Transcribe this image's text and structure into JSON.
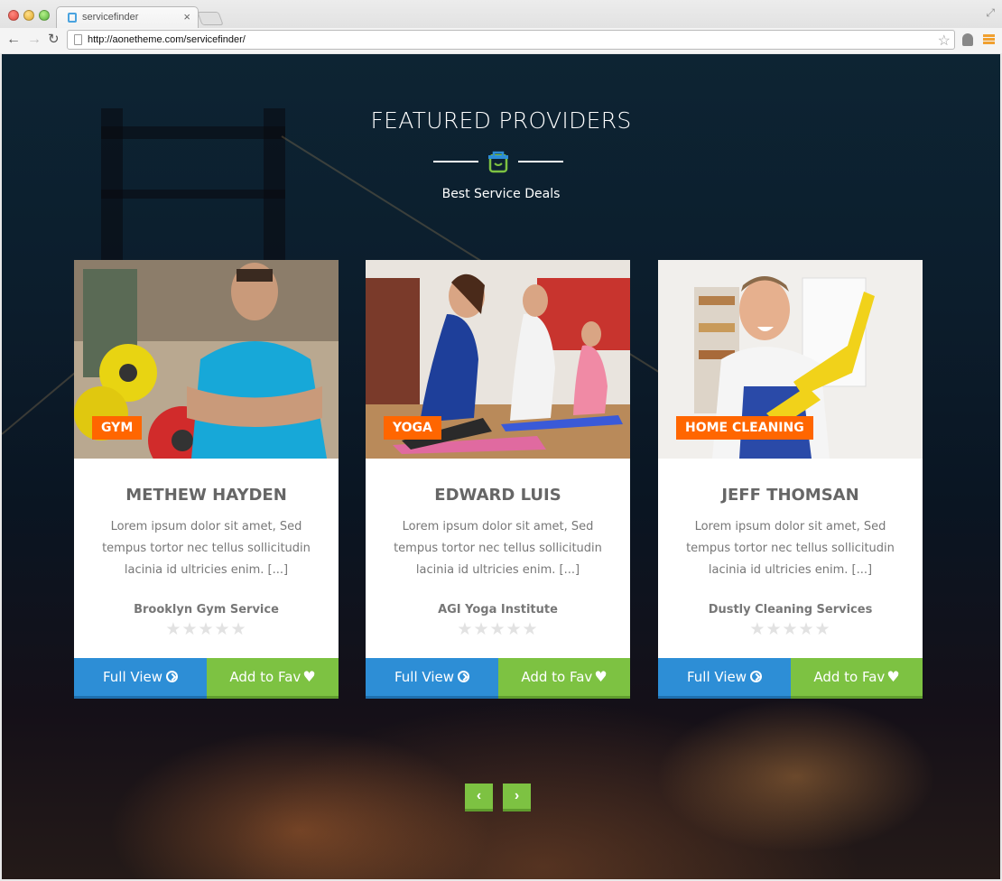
{
  "browser": {
    "tab_title": "servicefinder",
    "url": "http://aonetheme.com/servicefinder/"
  },
  "section": {
    "title": "FEATURED PROVIDERS",
    "subtitle": "Best Service Deals"
  },
  "cards": [
    {
      "tag": "GYM",
      "name": "METHEW HAYDEN",
      "description": "Lorem ipsum dolor sit amet, Sed tempus tortor nec tellus sollicitudin lacinia id ultricies enim. [...]",
      "company": "Brooklyn Gym Service",
      "rating_stars": "★★★★★",
      "full_view_label": "Full View",
      "fav_label": "Add to Fav"
    },
    {
      "tag": "YOGA",
      "name": "EDWARD LUIS",
      "description": "Lorem ipsum dolor sit amet, Sed tempus tortor nec tellus sollicitudin lacinia id ultricies enim. [...]",
      "company": "AGI Yoga Institute",
      "rating_stars": "★★★★★",
      "full_view_label": "Full View",
      "fav_label": "Add to Fav"
    },
    {
      "tag": "HOME CLEANING",
      "name": "JEFF THOMSAN",
      "description": "Lorem ipsum dolor sit amet, Sed tempus tortor nec tellus sollicitudin lacinia id ultricies enim. [...]",
      "company": "Dustly Cleaning Services",
      "rating_stars": "★★★★★",
      "full_view_label": "Full View",
      "fav_label": "Add to Fav"
    }
  ],
  "pager": {
    "prev": "‹",
    "next": "›"
  },
  "colors": {
    "accent_green": "#7dc242",
    "accent_blue": "#2d8ed6",
    "tag_orange": "#ff6600"
  }
}
